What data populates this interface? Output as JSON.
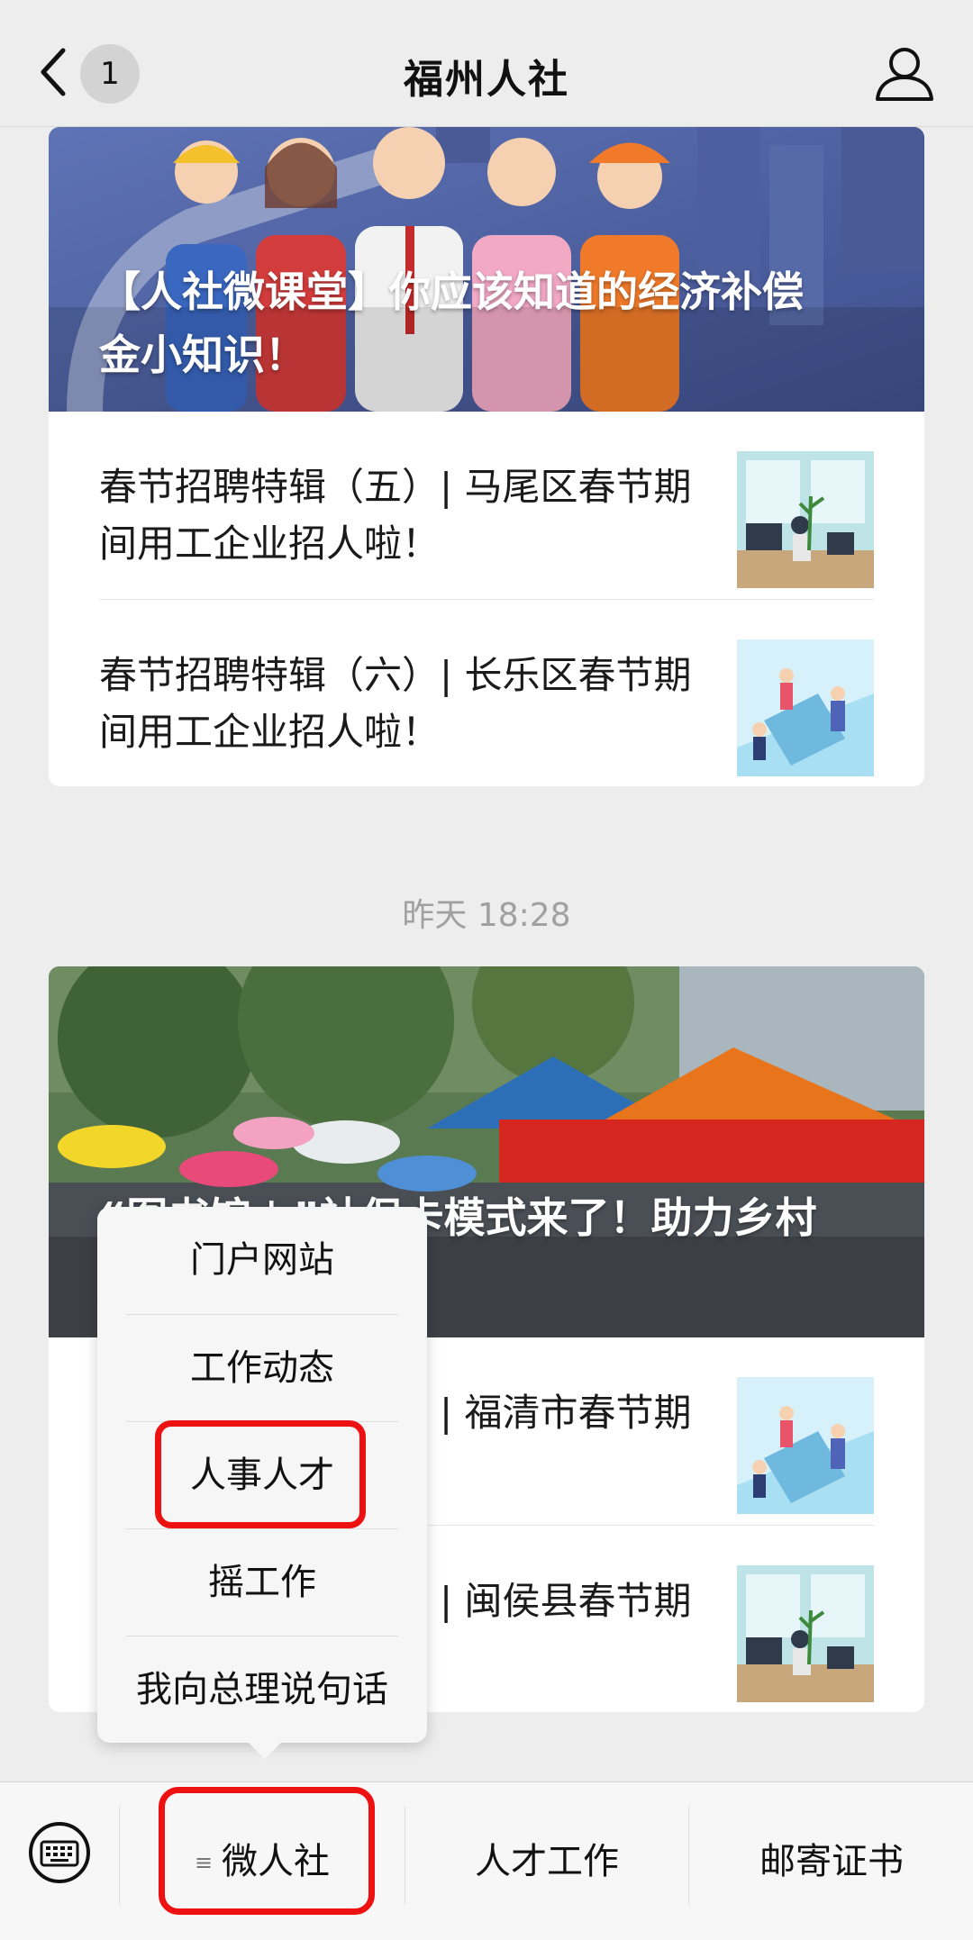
{
  "header": {
    "title": "福州人社",
    "unread_count": "1",
    "back_icon": "chevron-left-icon",
    "profile_icon": "person-icon"
  },
  "articles": [
    {
      "cover_title": "【人社微课堂】你应该知道的经济补偿金小知识！",
      "items": [
        {
          "title": "春节招聘特辑（五）| 马尾区春节期间用工企业招人啦！"
        },
        {
          "title": "春节招聘特辑（六）| 长乐区春节期间用工企业招人啦！"
        }
      ]
    },
    {
      "timestamp": "昨天 18:28",
      "cover_title": "“图书馆＋”社保卡模式来了！助力乡村文化振兴新方式！",
      "items": [
        {
          "title": "春节招聘特辑（七）| 福清市春节期间用工企业招人啦！"
        },
        {
          "title": "春节招聘特辑（八）| 闽侯县春节期间用工企业招人啦！"
        }
      ]
    }
  ],
  "popup_menu": {
    "items": [
      "门户网站",
      "工作动态",
      "人事人才",
      "摇工作",
      "我向总理说句话"
    ]
  },
  "bottom_menu": {
    "keyboard_icon": "keyboard-icon",
    "items": [
      "微人社",
      "人才工作",
      "邮寄证书"
    ],
    "menu_lines_icon": "≡"
  },
  "colors": {
    "highlight": "#ee1111",
    "background": "#ededed"
  }
}
